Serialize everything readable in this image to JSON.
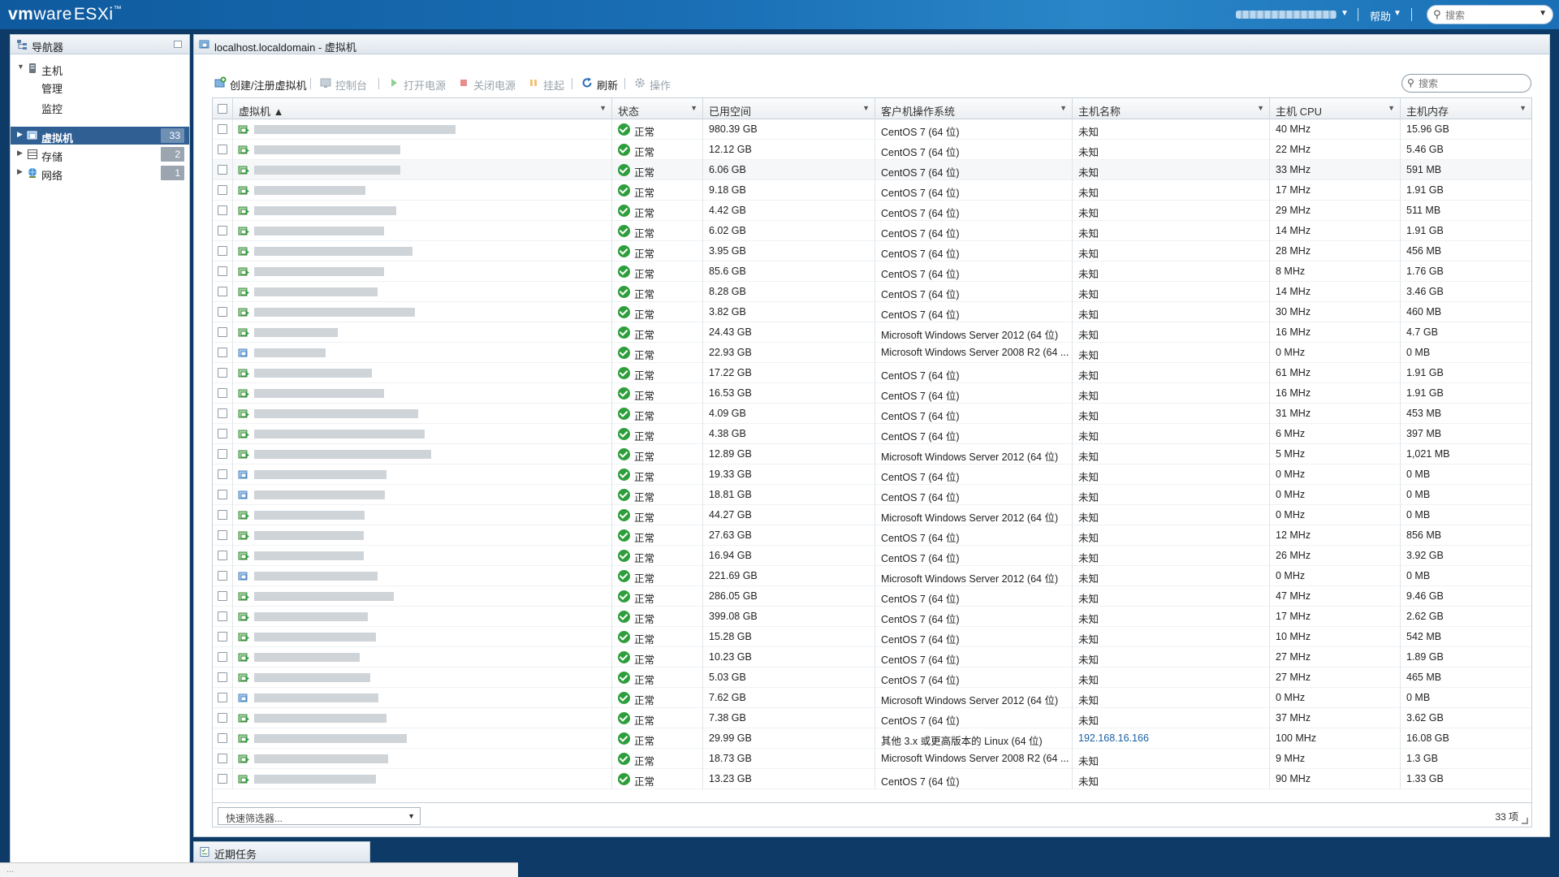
{
  "header": {
    "brand_vm": "vm",
    "brand_ware": "ware",
    "brand_esxi": "ESXi",
    "brand_tm": "™",
    "help_label": "帮助",
    "search_placeholder": "搜索"
  },
  "navigator": {
    "title": "导航器",
    "items": [
      {
        "label": "主机",
        "badge": ""
      },
      {
        "label": "管理",
        "badge": ""
      },
      {
        "label": "监控",
        "badge": ""
      },
      {
        "label": "虚拟机",
        "badge": "33"
      },
      {
        "label": "存储",
        "badge": "2"
      },
      {
        "label": "网络",
        "badge": "1"
      }
    ]
  },
  "content": {
    "title": "localhost.localdomain - 虚拟机",
    "search_placeholder": "搜索"
  },
  "toolbar": {
    "create": "创建/注册虚拟机",
    "console": "控制台",
    "power_on": "打开电源",
    "power_off": "关闭电源",
    "suspend": "挂起",
    "refresh": "刷新",
    "actions": "操作"
  },
  "grid": {
    "columns": [
      "虚拟机 ▲",
      "状态",
      "已用空间",
      "客户机操作系统",
      "主机名称",
      "主机 CPU",
      "主机内存"
    ],
    "rows": [
      {
        "status": "正常",
        "space": "980.39 GB",
        "os": "CentOS 7 (64 位)",
        "host": "未知",
        "cpu": "40 MHz",
        "mem": "15.96 GB"
      },
      {
        "status": "正常",
        "space": "12.12 GB",
        "os": "CentOS 7 (64 位)",
        "host": "未知",
        "cpu": "22 MHz",
        "mem": "5.46 GB"
      },
      {
        "status": "正常",
        "space": "6.06 GB",
        "os": "CentOS 7 (64 位)",
        "host": "未知",
        "cpu": "33 MHz",
        "mem": "591 MB"
      },
      {
        "status": "正常",
        "space": "9.18 GB",
        "os": "CentOS 7 (64 位)",
        "host": "未知",
        "cpu": "17 MHz",
        "mem": "1.91 GB"
      },
      {
        "status": "正常",
        "space": "4.42 GB",
        "os": "CentOS 7 (64 位)",
        "host": "未知",
        "cpu": "29 MHz",
        "mem": "511 MB"
      },
      {
        "status": "正常",
        "space": "6.02 GB",
        "os": "CentOS 7 (64 位)",
        "host": "未知",
        "cpu": "14 MHz",
        "mem": "1.91 GB"
      },
      {
        "status": "正常",
        "space": "3.95 GB",
        "os": "CentOS 7 (64 位)",
        "host": "未知",
        "cpu": "28 MHz",
        "mem": "456 MB"
      },
      {
        "status": "正常",
        "space": "85.6 GB",
        "os": "CentOS 7 (64 位)",
        "host": "未知",
        "cpu": "8 MHz",
        "mem": "1.76 GB"
      },
      {
        "status": "正常",
        "space": "8.28 GB",
        "os": "CentOS 7 (64 位)",
        "host": "未知",
        "cpu": "14 MHz",
        "mem": "3.46 GB"
      },
      {
        "status": "正常",
        "space": "3.82 GB",
        "os": "CentOS 7 (64 位)",
        "host": "未知",
        "cpu": "30 MHz",
        "mem": "460 MB"
      },
      {
        "status": "正常",
        "space": "24.43 GB",
        "os": "Microsoft Windows Server 2012 (64 位)",
        "host": "未知",
        "cpu": "16 MHz",
        "mem": "4.7 GB"
      },
      {
        "status": "正常",
        "space": "22.93 GB",
        "os": "Microsoft Windows Server 2008 R2 (64 ...",
        "host": "未知",
        "cpu": "0 MHz",
        "mem": "0 MB"
      },
      {
        "status": "正常",
        "space": "17.22 GB",
        "os": "CentOS 7 (64 位)",
        "host": "未知",
        "cpu": "61 MHz",
        "mem": "1.91 GB"
      },
      {
        "status": "正常",
        "space": "16.53 GB",
        "os": "CentOS 7 (64 位)",
        "host": "未知",
        "cpu": "16 MHz",
        "mem": "1.91 GB"
      },
      {
        "status": "正常",
        "space": "4.09 GB",
        "os": "CentOS 7 (64 位)",
        "host": "未知",
        "cpu": "31 MHz",
        "mem": "453 MB"
      },
      {
        "status": "正常",
        "space": "4.38 GB",
        "os": "CentOS 7 (64 位)",
        "host": "未知",
        "cpu": "6 MHz",
        "mem": "397 MB"
      },
      {
        "status": "正常",
        "space": "12.89 GB",
        "os": "Microsoft Windows Server 2012 (64 位)",
        "host": "未知",
        "cpu": "5 MHz",
        "mem": "1,021 MB"
      },
      {
        "status": "正常",
        "space": "19.33 GB",
        "os": "CentOS 7 (64 位)",
        "host": "未知",
        "cpu": "0 MHz",
        "mem": "0 MB"
      },
      {
        "status": "正常",
        "space": "18.81 GB",
        "os": "CentOS 7 (64 位)",
        "host": "未知",
        "cpu": "0 MHz",
        "mem": "0 MB"
      },
      {
        "status": "正常",
        "space": "44.27 GB",
        "os": "Microsoft Windows Server 2012 (64 位)",
        "host": "未知",
        "cpu": "0 MHz",
        "mem": "0 MB"
      },
      {
        "status": "正常",
        "space": "27.63 GB",
        "os": "CentOS 7 (64 位)",
        "host": "未知",
        "cpu": "12 MHz",
        "mem": "856 MB"
      },
      {
        "status": "正常",
        "space": "16.94 GB",
        "os": "CentOS 7 (64 位)",
        "host": "未知",
        "cpu": "26 MHz",
        "mem": "3.92 GB"
      },
      {
        "status": "正常",
        "space": "221.69 GB",
        "os": "Microsoft Windows Server 2012 (64 位)",
        "host": "未知",
        "cpu": "0 MHz",
        "mem": "0 MB"
      },
      {
        "status": "正常",
        "space": "286.05 GB",
        "os": "CentOS 7 (64 位)",
        "host": "未知",
        "cpu": "47 MHz",
        "mem": "9.46 GB"
      },
      {
        "status": "正常",
        "space": "399.08 GB",
        "os": "CentOS 7 (64 位)",
        "host": "未知",
        "cpu": "17 MHz",
        "mem": "2.62 GB"
      },
      {
        "status": "正常",
        "space": "15.28 GB",
        "os": "CentOS 7 (64 位)",
        "host": "未知",
        "cpu": "10 MHz",
        "mem": "542 MB"
      },
      {
        "status": "正常",
        "space": "10.23 GB",
        "os": "CentOS 7 (64 位)",
        "host": "未知",
        "cpu": "27 MHz",
        "mem": "1.89 GB"
      },
      {
        "status": "正常",
        "space": "5.03 GB",
        "os": "CentOS 7 (64 位)",
        "host": "未知",
        "cpu": "27 MHz",
        "mem": "465 MB"
      },
      {
        "status": "正常",
        "space": "7.62 GB",
        "os": "Microsoft Windows Server 2012 (64 位)",
        "host": "未知",
        "cpu": "0 MHz",
        "mem": "0 MB"
      },
      {
        "status": "正常",
        "space": "7.38 GB",
        "os": "CentOS 7 (64 位)",
        "host": "未知",
        "cpu": "37 MHz",
        "mem": "3.62 GB"
      },
      {
        "status": "正常",
        "space": "29.99 GB",
        "os": "其他 3.x 或更高版本的 Linux (64 位)",
        "host": "192.168.16.166",
        "cpu": "100 MHz",
        "mem": "16.08 GB"
      },
      {
        "status": "正常",
        "space": "18.73 GB",
        "os": "Microsoft Windows Server 2008 R2 (64 ...",
        "host": "未知",
        "cpu": "9 MHz",
        "mem": "1.3 GB"
      },
      {
        "status": "正常",
        "space": "13.23 GB",
        "os": "CentOS 7 (64 位)",
        "host": "未知",
        "cpu": "90 MHz",
        "mem": "1.33 GB"
      }
    ],
    "quick_filter": "快速筛选器...",
    "item_count": "33 项"
  },
  "recent_tasks": {
    "title": "近期任务"
  },
  "statusbar": {
    "text": "..."
  },
  "colors": {
    "header_blue": "#1a6fb5",
    "selected_nav": "#2f5f93",
    "status_ok": "#2e9e3c",
    "link_blue": "#1a5fa5"
  }
}
